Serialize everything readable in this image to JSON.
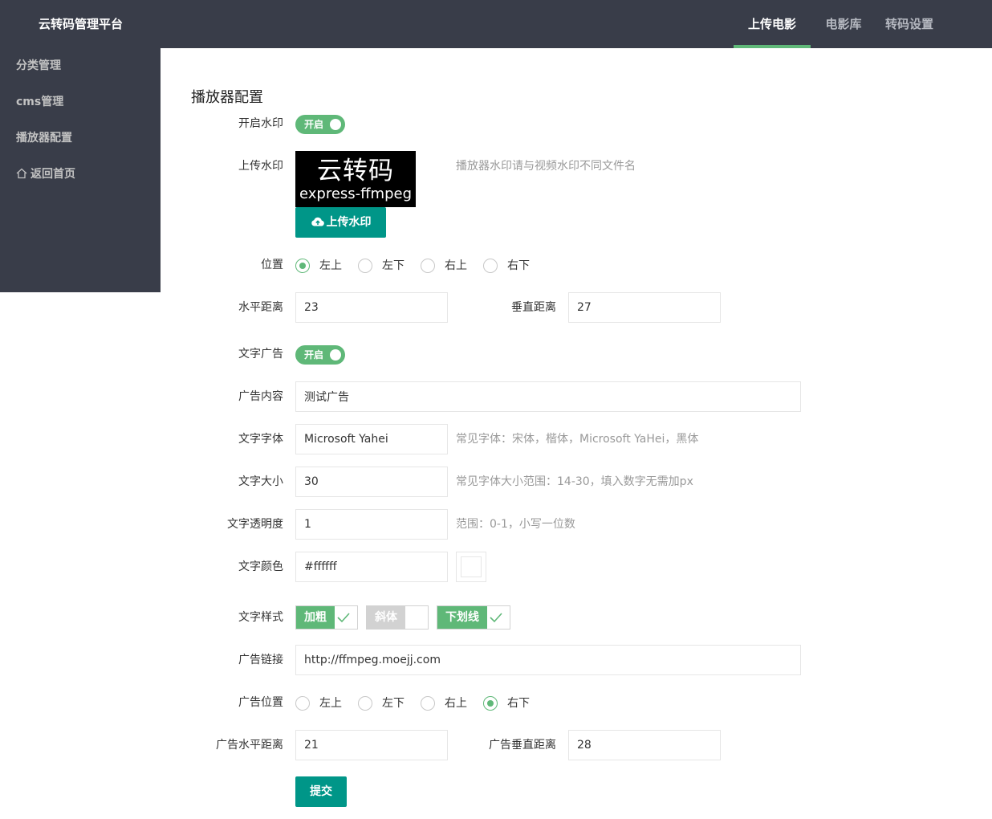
{
  "app": {
    "title": "云转码管理平台"
  },
  "nav": {
    "items": [
      "上传电影",
      "电影库",
      "转码设置"
    ],
    "active": "上传电影"
  },
  "sidebar": {
    "items": [
      "分类管理",
      "cms管理",
      "播放器配置",
      "返回首页"
    ]
  },
  "colors": {
    "header_bg": "#393d49",
    "accent": "#5fb878",
    "button": "#009688"
  },
  "form": {
    "title": "播放器配置",
    "watermark_switch": {
      "label": "开启水印",
      "state": "开启"
    },
    "upload_watermark": {
      "label": "上传水印",
      "preview_line1": "云转码",
      "preview_line2": "express-ffmpeg",
      "button_label": "上传水印",
      "hint": "播放器水印请与视频水印不同文件名"
    },
    "position": {
      "label": "位置",
      "options": [
        "左上",
        "左下",
        "右上",
        "右下"
      ],
      "selected": "左上"
    },
    "horizontal_distance": {
      "label": "水平距离",
      "value": "23"
    },
    "vertical_distance": {
      "label": "垂直距离",
      "value": "27"
    },
    "text_ad_switch": {
      "label": "文字广告",
      "state": "开启"
    },
    "ad_content": {
      "label": "广告内容",
      "value": "测试广告"
    },
    "font_family": {
      "label": "文字字体",
      "value": "Microsoft Yahei",
      "hint": "常见字体：宋体，楷体，Microsoft YaHei，黑体"
    },
    "font_size": {
      "label": "文字大小",
      "value": "30",
      "hint": "常见字体大小范围：14-30，填入数字无需加px"
    },
    "opacity": {
      "label": "文字透明度",
      "value": "1",
      "hint": "范围：0-1，小写一位数"
    },
    "color": {
      "label": "文字颜色",
      "value": "#ffffff"
    },
    "text_style": {
      "label": "文字样式",
      "options": [
        {
          "label": "加粗",
          "checked": true
        },
        {
          "label": "斜体",
          "checked": false
        },
        {
          "label": "下划线",
          "checked": true
        }
      ]
    },
    "ad_link": {
      "label": "广告链接",
      "value": "http://ffmpeg.moejj.com"
    },
    "ad_position": {
      "label": "广告位置",
      "options": [
        "左上",
        "左下",
        "右上",
        "右下"
      ],
      "selected": "右下"
    },
    "ad_horizontal_distance": {
      "label": "广告水平距离",
      "value": "21"
    },
    "ad_vertical_distance": {
      "label": "广告垂直距离",
      "value": "28"
    },
    "submit_label": "提交"
  }
}
